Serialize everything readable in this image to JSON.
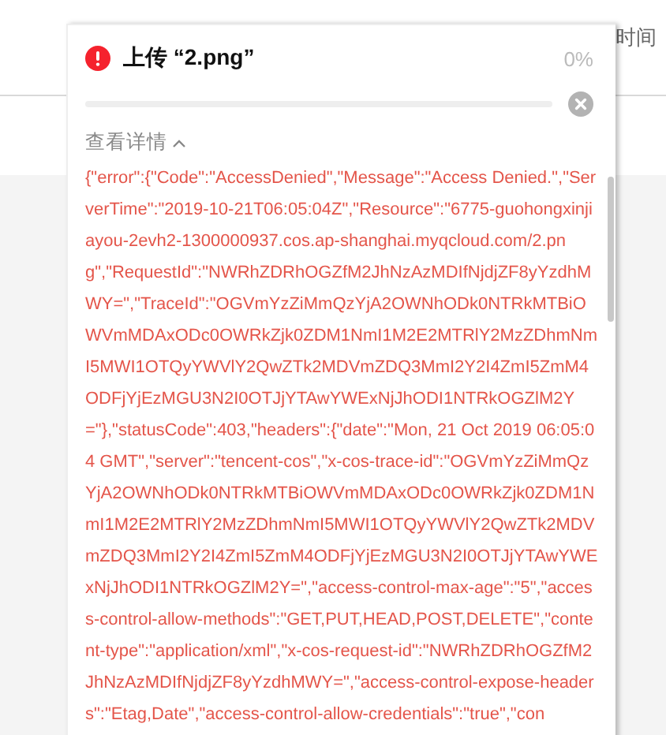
{
  "background": {
    "column_header": "时间"
  },
  "upload": {
    "failed": true,
    "title": "上传 “2.png”",
    "percent": "0%",
    "level": 0
  },
  "details": {
    "label": "查看详情",
    "expanded": true,
    "text": "{\"error\":{\"Code\":\"AccessDenied\",\"Message\":\"Access Denied.\",\"ServerTime\":\"2019-10-21T06:05:04Z\",\"Resource\":\"6775-guohongxinjiayou-2evh2-1300000937.cos.ap-shanghai.myqcloud.com/2.png\",\"RequestId\":\"NWRhZDRhOGZfM2JhNzAzMDIfNjdjZF8yYzdhMWY=\",\"TraceId\":\"OGVmYzZiMmQzYjA2OWNhODk0NTRkMTBiOWVmMDAxODc0OWRkZjk0ZDM1NmI1M2E2MTRlY2MzZDhmNmI5MWI1OTQyYWVlY2QwZTk2MDVmZDQ3MmI2Y2I4ZmI5ZmM4ODFjYjEzMGU3N2I0OTJjYTAwYWExNjJhODI1NTRkOGZlM2Y=\"},\"statusCode\":403,\"headers\":{\"date\":\"Mon, 21 Oct 2019 06:05:04 GMT\",\"server\":\"tencent-cos\",\"x-cos-trace-id\":\"OGVmYzZiMmQzYjA2OWNhODk0NTRkMTBiOWVmMDAxODc0OWRkZjk0ZDM1NmI1M2E2MTRlY2MzZDhmNmI5MWI1OTQyYWVlY2QwZTk2MDVmZDQ3MmI2Y2I4ZmI5ZmM4ODFjYjEzMGU3N2I0OTJjYTAwYWExNjJhODI1NTRkOGZlM2Y=\",\"access-control-max-age\":\"5\",\"access-control-allow-methods\":\"GET,PUT,HEAD,POST,DELETE\",\"content-type\":\"application/xml\",\"x-cos-request-id\":\"NWRhZDRhOGZfM2JhNzAzMDIfNjdjZF8yYzdhMWY=\",\"access-control-expose-headers\":\"Etag,Date\",\"access-control-allow-credentials\":\"true\",\"con"
  }
}
